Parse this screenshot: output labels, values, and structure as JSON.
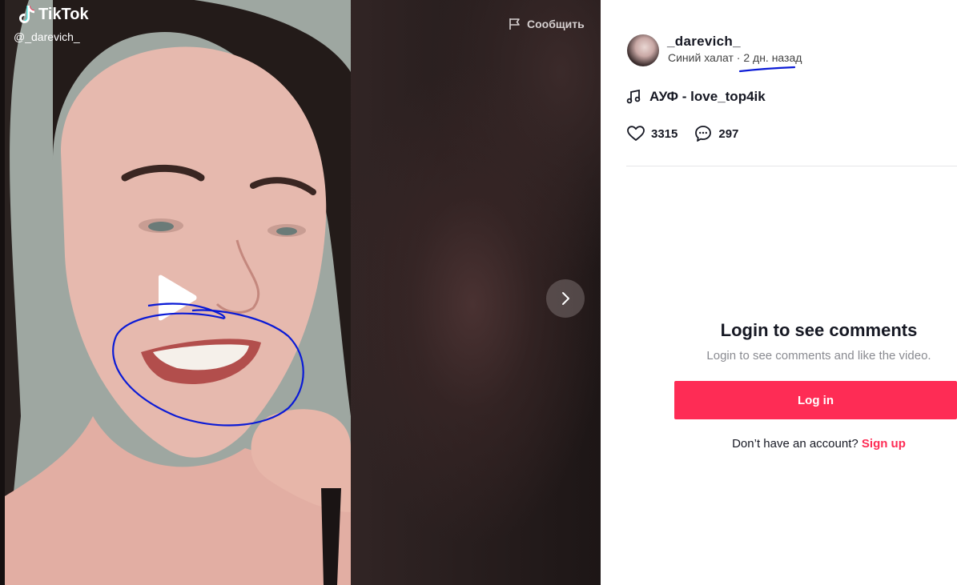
{
  "video": {
    "logo_text": "TikTok",
    "creator_handle": "@_darevich_",
    "report_label": "Сообщить"
  },
  "author": {
    "username": "_darevich_",
    "nickname": "Синий халат",
    "separator": "·",
    "posted": "2 дн. назад"
  },
  "music": {
    "title": "АУФ - love_top4ik"
  },
  "stats": {
    "likes": "3315",
    "comments": "297"
  },
  "login": {
    "title": "Login to see comments",
    "subtitle": "Login to see comments and like the video.",
    "button_label": "Log in",
    "signup_prompt": "Don’t have an account?",
    "signup_link": "Sign up"
  },
  "colors": {
    "accent": "#fe2c55",
    "annotation": "#0b1bd6"
  }
}
